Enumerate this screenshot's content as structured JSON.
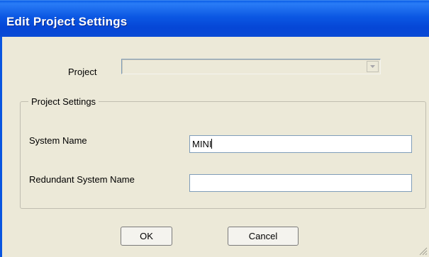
{
  "window": {
    "title": "Edit Project Settings"
  },
  "project": {
    "label": "Project",
    "value": ""
  },
  "project_settings": {
    "group_label": "Project Settings",
    "system_name_label": "System Name",
    "system_name_value": "MINI",
    "redundant_label": "Redundant System Name",
    "redundant_value": ""
  },
  "buttons": {
    "ok": "OK",
    "cancel": "Cancel"
  },
  "colors": {
    "titlebar": "#0546d6",
    "dialog_bg": "#ece9d8",
    "input_border": "#7f9db9"
  },
  "icons": {
    "dropdown": "chevron-down-icon",
    "resize": "resize-grip-icon"
  }
}
